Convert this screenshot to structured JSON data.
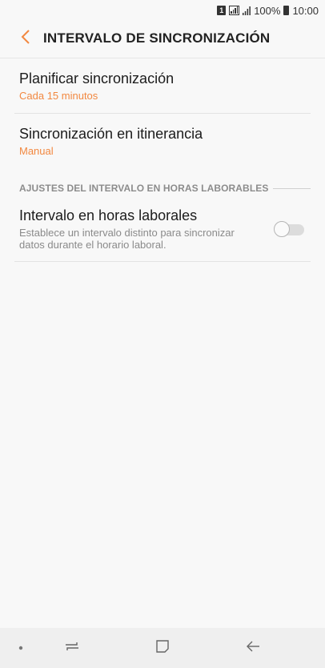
{
  "status_bar": {
    "sim_label": "1",
    "battery_percent": "100%",
    "time": "10:00",
    "icons": [
      "sim-icon",
      "signal-box-icon",
      "signal-bars-icon",
      "battery-icon"
    ]
  },
  "app_bar": {
    "title": "INTERVALO DE SINCRONIZACIÓN",
    "back_icon": "chevron-left-icon"
  },
  "settings": {
    "schedule": {
      "title": "Planificar sincronización",
      "value": "Cada 15 minutos"
    },
    "roaming": {
      "title": "Sincronización en itinerancia",
      "value": "Manual"
    },
    "section_header": "AJUSTES DEL INTERVALO EN HORAS LABORABLES",
    "work_hours": {
      "title": "Intervalo en horas laborales",
      "description": "Establece un intervalo distinto para sincronizar datos durante el horario laboral.",
      "enabled": false
    }
  },
  "nav_bar": {
    "icons": [
      "dot-icon",
      "recents-icon",
      "home-icon",
      "back-arrow-icon"
    ]
  },
  "colors": {
    "accent": "#f28840",
    "background": "#f8f8f8",
    "nav_background": "#efefef"
  }
}
